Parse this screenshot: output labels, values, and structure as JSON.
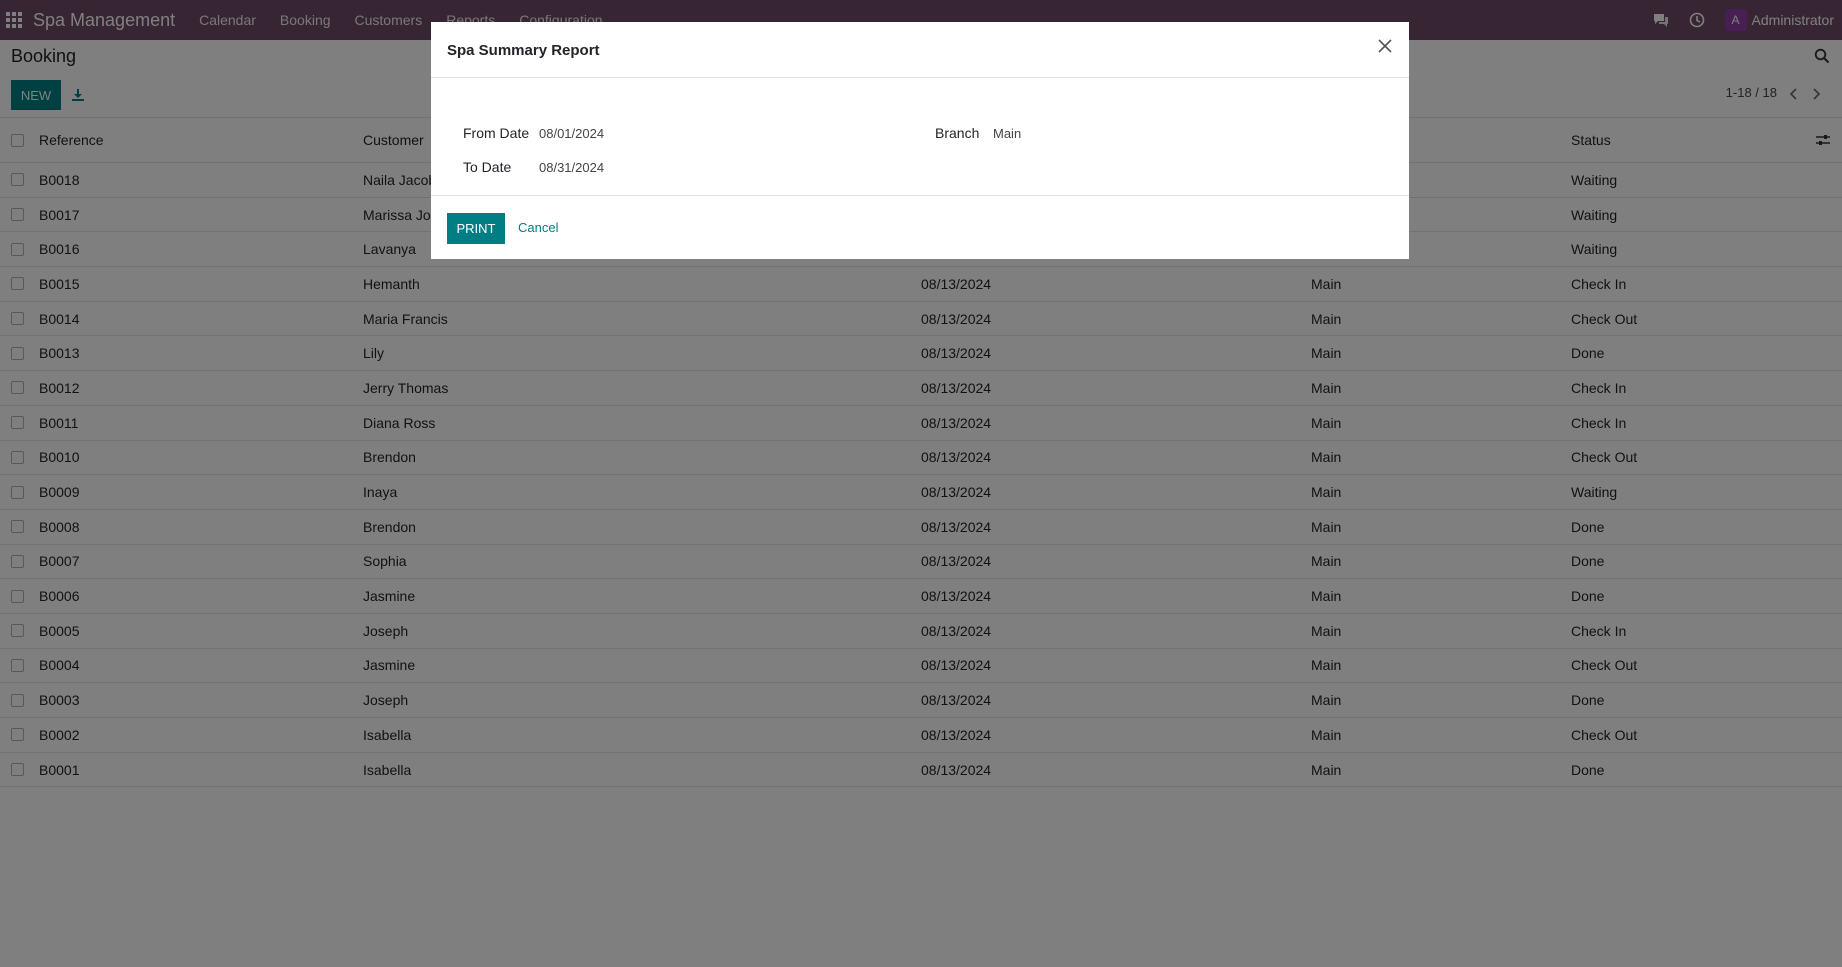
{
  "navbar": {
    "brand": "Spa Management",
    "menu": [
      "Calendar",
      "Booking",
      "Customers",
      "Reports",
      "Configuration"
    ],
    "avatar_initial": "A",
    "user": "Administrator"
  },
  "control_panel": {
    "title": "Booking",
    "new_label": "NEW",
    "pager": "1-18 / 18"
  },
  "table": {
    "headers": {
      "reference": "Reference",
      "customer": "Customer",
      "status": "Status"
    },
    "rows": [
      {
        "ref": "B0018",
        "customer": "Naila Jacob",
        "date": "",
        "branch": "",
        "status": "Waiting"
      },
      {
        "ref": "B0017",
        "customer": "Marissa Joh",
        "date": "",
        "branch": "",
        "status": "Waiting"
      },
      {
        "ref": "B0016",
        "customer": "Lavanya",
        "date": "",
        "branch": "",
        "status": "Waiting"
      },
      {
        "ref": "B0015",
        "customer": "Hemanth",
        "date": "08/13/2024",
        "branch": "Main",
        "status": "Check In"
      },
      {
        "ref": "B0014",
        "customer": "Maria Francis",
        "date": "08/13/2024",
        "branch": "Main",
        "status": "Check Out"
      },
      {
        "ref": "B0013",
        "customer": "Lily",
        "date": "08/13/2024",
        "branch": "Main",
        "status": "Done"
      },
      {
        "ref": "B0012",
        "customer": "Jerry Thomas",
        "date": "08/13/2024",
        "branch": "Main",
        "status": "Check In"
      },
      {
        "ref": "B0011",
        "customer": "Diana Ross",
        "date": "08/13/2024",
        "branch": "Main",
        "status": "Check In"
      },
      {
        "ref": "B0010",
        "customer": "Brendon",
        "date": "08/13/2024",
        "branch": "Main",
        "status": "Check Out"
      },
      {
        "ref": "B0009",
        "customer": "Inaya",
        "date": "08/13/2024",
        "branch": "Main",
        "status": "Waiting"
      },
      {
        "ref": "B0008",
        "customer": "Brendon",
        "date": "08/13/2024",
        "branch": "Main",
        "status": "Done"
      },
      {
        "ref": "B0007",
        "customer": "Sophia",
        "date": "08/13/2024",
        "branch": "Main",
        "status": "Done"
      },
      {
        "ref": "B0006",
        "customer": "Jasmine",
        "date": "08/13/2024",
        "branch": "Main",
        "status": "Done"
      },
      {
        "ref": "B0005",
        "customer": "Joseph",
        "date": "08/13/2024",
        "branch": "Main",
        "status": "Check In"
      },
      {
        "ref": "B0004",
        "customer": "Jasmine",
        "date": "08/13/2024",
        "branch": "Main",
        "status": "Check Out"
      },
      {
        "ref": "B0003",
        "customer": "Joseph",
        "date": "08/13/2024",
        "branch": "Main",
        "status": "Done"
      },
      {
        "ref": "B0002",
        "customer": "Isabella",
        "date": "08/13/2024",
        "branch": "Main",
        "status": "Check Out"
      },
      {
        "ref": "B0001",
        "customer": "Isabella",
        "date": "08/13/2024",
        "branch": "Main",
        "status": "Done"
      }
    ]
  },
  "dialog": {
    "title": "Spa Summary Report",
    "from_date_label": "From Date",
    "from_date": "08/01/2024",
    "to_date_label": "To Date",
    "to_date": "08/31/2024",
    "branch_label": "Branch",
    "branch": "Main",
    "print_label": "PRINT",
    "cancel_label": "Cancel"
  },
  "colors": {
    "navbar": "#714b67",
    "primary": "#017e84",
    "avatar": "#8e3fa4"
  }
}
